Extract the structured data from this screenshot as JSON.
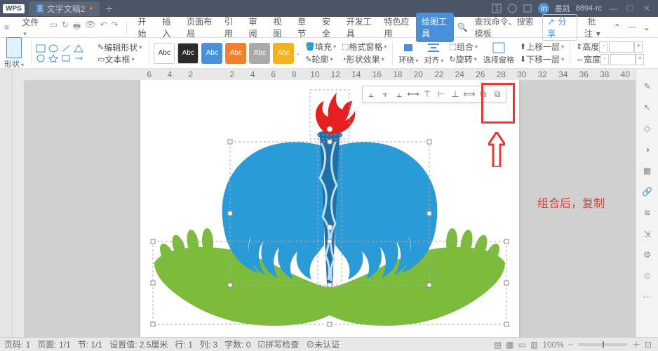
{
  "titlebar": {
    "app": "WPS",
    "doc": "文字文稿2",
    "user": "墨凯",
    "build": "8894-rc"
  },
  "menubar": {
    "file": "文件",
    "tabs": [
      "开始",
      "插入",
      "页面布局",
      "引用",
      "审阅",
      "视图",
      "章节",
      "安全",
      "开发工具",
      "特色应用",
      "绘图工具"
    ],
    "active_index": 10,
    "search": "查找命令、搜索模板",
    "share": "分享",
    "comment": "批注"
  },
  "toolbar": {
    "shape": "形状",
    "edit_shape": "编辑形状",
    "textbox": "文本框",
    "abc": "Abc",
    "fill": "填充",
    "outline": "轮廓",
    "shape_effect": "形状效果",
    "format_pane": "格式窗格",
    "wrap": "环绕",
    "align": "对齐",
    "group": "组合",
    "rotate": "旋转",
    "select_pane": "选择窗格",
    "move_up": "上移一层",
    "move_down": "下移一层",
    "height": "高度",
    "width": "宽度"
  },
  "ruler_values": [
    "6",
    "4",
    "2",
    "",
    "2",
    "4",
    "6",
    "8",
    "10",
    "12",
    "14",
    "16",
    "18",
    "20",
    "22",
    "24",
    "26",
    "28",
    "30",
    "32",
    "34",
    "36",
    "38",
    "40"
  ],
  "popup_labels": [
    "align-left-icon",
    "align-center-icon",
    "align-right-icon",
    "distribute-h-icon",
    "align-top-icon",
    "align-middle-icon",
    "align-bottom-icon",
    "distribute-v-icon",
    "group-icon",
    "copy-icon"
  ],
  "annotation_text": "组合后，复制",
  "rightpanel": [
    "pencil-icon",
    "arrow-icon",
    "shape-icon",
    "bucket-icon",
    "grid-icon",
    "link-icon",
    "layers-icon",
    "export-icon",
    "settings-icon",
    "history-icon",
    "more-icon"
  ],
  "statusbar": {
    "page_label": "页码: 1",
    "page_of": "页面: 1/1",
    "sec": "节: 1/1",
    "setting": "设置值: 2.5厘米",
    "row": "行: 1",
    "col": "列: 3",
    "chars": "字数: 0",
    "spell": "拼写检查",
    "cert": "未认证",
    "zoom": "100%"
  }
}
